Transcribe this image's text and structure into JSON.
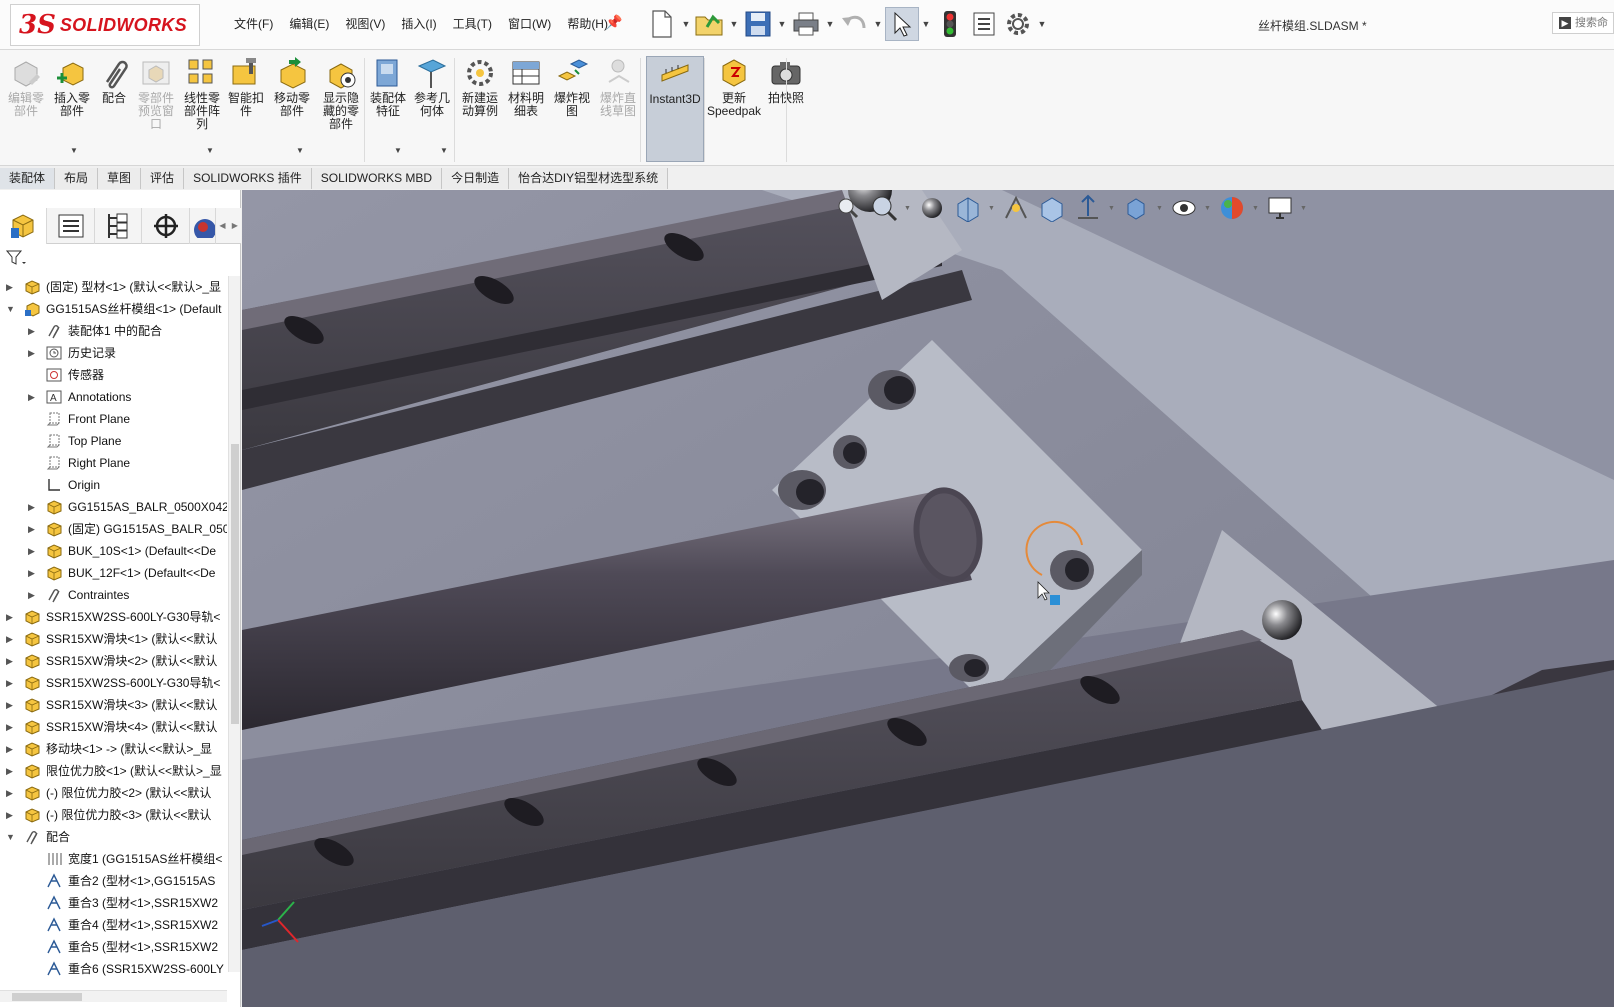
{
  "app": {
    "logo_ds": "3S",
    "logo_text": "SOLIDWORKS",
    "document_title": "丝杆模组.SLDASM *",
    "search_placeholder": "搜索命"
  },
  "menu": [
    "文件(F)",
    "编辑(E)",
    "视图(V)",
    "插入(I)",
    "工具(T)",
    "窗口(W)",
    "帮助(H)"
  ],
  "quick_access_icons": [
    "new-document-icon",
    "open-icon",
    "save-icon",
    "print-icon",
    "undo-icon",
    "select-arrow-icon",
    "rebuild-traffic-light-icon",
    "file-properties-icon",
    "options-gear-icon"
  ],
  "ribbon": [
    {
      "label": "编辑零\n部件",
      "icon": "edit-component-icon",
      "disabled": true
    },
    {
      "label": "插入零\n部件",
      "icon": "insert-component-icon",
      "disabled": false
    },
    {
      "label": "配合",
      "icon": "mate-paperclip-icon",
      "disabled": false
    },
    {
      "label": "零部件\n预览窗\n口",
      "icon": "component-preview-icon",
      "disabled": true
    },
    {
      "label": "线性零\n部件阵\n列",
      "icon": "linear-pattern-icon",
      "disabled": false
    },
    {
      "label": "智能扣\n件",
      "icon": "smart-fasteners-icon",
      "disabled": false
    },
    {
      "label": "移动零\n部件",
      "icon": "move-component-icon",
      "disabled": false
    },
    {
      "label": "显示隐\n藏的零\n部件",
      "icon": "show-hidden-components-icon",
      "disabled": false
    },
    {
      "label": "装配体\n特征",
      "icon": "assembly-features-icon",
      "disabled": false
    },
    {
      "label": "参考几\n何体",
      "icon": "reference-geometry-icon",
      "disabled": false
    },
    {
      "label": "新建运\n动算例",
      "icon": "new-motion-study-icon",
      "disabled": false
    },
    {
      "label": "材料明\n细表",
      "icon": "bill-of-materials-icon",
      "disabled": false
    },
    {
      "label": "爆炸视\n图",
      "icon": "exploded-view-icon",
      "disabled": false
    },
    {
      "label": "爆炸直\n线草图",
      "icon": "explode-line-sketch-icon",
      "disabled": true
    },
    {
      "label": "Instant3D",
      "icon": "instant3d-icon",
      "disabled": false,
      "active": true
    },
    {
      "label": "更新\nSpeedpak",
      "icon": "speedpak-icon",
      "disabled": false
    },
    {
      "label": "拍快照",
      "icon": "snapshot-camera-icon",
      "disabled": false
    }
  ],
  "command_tabs": [
    "装配体",
    "布局",
    "草图",
    "评估",
    "SOLIDWORKS 插件",
    "SOLIDWORKS MBD",
    "今日制造",
    "怡合达DIY铝型材选型系统"
  ],
  "command_tab_active": "装配体",
  "fm_tabs": [
    "featuremanager-icon",
    "propertymanager-icon",
    "configurationmanager-icon",
    "dimxpert-icon",
    "display-manager-icon"
  ],
  "tree": [
    {
      "level": 0,
      "arrow": "right",
      "icon": "part-icon",
      "text": "(固定) 型材<1> (默认<<默认>_显"
    },
    {
      "level": 0,
      "arrow": "down",
      "icon": "subassembly-icon",
      "text": "GG1515AS丝杆模组<1> (Default"
    },
    {
      "level": 1,
      "arrow": "right",
      "icon": "mates-folder-icon",
      "text": "装配体1 中的配合"
    },
    {
      "level": 1,
      "arrow": "right",
      "icon": "history-icon",
      "text": "历史记录"
    },
    {
      "level": 1,
      "arrow": "",
      "icon": "sensor-icon",
      "text": "传感器"
    },
    {
      "level": 1,
      "arrow": "right",
      "icon": "annotations-icon",
      "text": "Annotations"
    },
    {
      "level": 1,
      "arrow": "",
      "icon": "plane-icon",
      "text": "Front Plane"
    },
    {
      "level": 1,
      "arrow": "",
      "icon": "plane-icon",
      "text": "Top Plane"
    },
    {
      "level": 1,
      "arrow": "",
      "icon": "plane-icon",
      "text": "Right Plane"
    },
    {
      "level": 1,
      "arrow": "",
      "icon": "origin-icon",
      "text": "Origin"
    },
    {
      "level": 1,
      "arrow": "right",
      "icon": "part-icon",
      "text": "GG1515AS_BALR_0500X042"
    },
    {
      "level": 1,
      "arrow": "right",
      "icon": "part-icon",
      "text": "(固定) GG1515AS_BALR_050"
    },
    {
      "level": 1,
      "arrow": "right",
      "icon": "part-icon",
      "text": "BUK_10S<1> (Default<<De"
    },
    {
      "level": 1,
      "arrow": "right",
      "icon": "part-icon",
      "text": "BUK_12F<1> (Default<<De"
    },
    {
      "level": 1,
      "arrow": "right",
      "icon": "mates-folder-icon",
      "text": "Contraintes"
    },
    {
      "level": 0,
      "arrow": "right",
      "icon": "part-icon",
      "text": "SSR15XW2SS-600LY-G30导轨<"
    },
    {
      "level": 0,
      "arrow": "right",
      "icon": "part-icon",
      "text": "SSR15XW滑块<1> (默认<<默认"
    },
    {
      "level": 0,
      "arrow": "right",
      "icon": "part-icon",
      "text": "SSR15XW滑块<2> (默认<<默认"
    },
    {
      "level": 0,
      "arrow": "right",
      "icon": "part-icon",
      "text": "SSR15XW2SS-600LY-G30导轨<"
    },
    {
      "level": 0,
      "arrow": "right",
      "icon": "part-icon",
      "text": "SSR15XW滑块<3> (默认<<默认"
    },
    {
      "level": 0,
      "arrow": "right",
      "icon": "part-icon",
      "text": "SSR15XW滑块<4> (默认<<默认"
    },
    {
      "level": 0,
      "arrow": "right",
      "icon": "part-icon",
      "text": "移动块<1> -> (默认<<默认>_显"
    },
    {
      "level": 0,
      "arrow": "right",
      "icon": "part-icon",
      "text": "限位优力胶<1> (默认<<默认>_显"
    },
    {
      "level": 0,
      "arrow": "right",
      "icon": "part-icon",
      "text": "(-) 限位优力胶<2> (默认<<默认"
    },
    {
      "level": 0,
      "arrow": "right",
      "icon": "part-icon",
      "text": "(-) 限位优力胶<3> (默认<<默认"
    },
    {
      "level": 0,
      "arrow": "down",
      "icon": "mates-folder-icon",
      "text": "配合"
    },
    {
      "level": 1,
      "arrow": "",
      "icon": "width-mate-icon",
      "text": "宽度1 (GG1515AS丝杆模组<"
    },
    {
      "level": 1,
      "arrow": "",
      "icon": "coincident-mate-icon",
      "text": "重合2 (型材<1>,GG1515AS"
    },
    {
      "level": 1,
      "arrow": "",
      "icon": "coincident-mate-icon",
      "text": "重合3 (型材<1>,SSR15XW2"
    },
    {
      "level": 1,
      "arrow": "",
      "icon": "coincident-mate-icon",
      "text": "重合4 (型材<1>,SSR15XW2"
    },
    {
      "level": 1,
      "arrow": "",
      "icon": "coincident-mate-icon",
      "text": "重合5 (型材<1>,SSR15XW2"
    },
    {
      "level": 1,
      "arrow": "",
      "icon": "coincident-mate-icon",
      "text": "重合6 (SSR15XW2SS-600LY"
    }
  ],
  "heads_up_toolbar": [
    "zoom-to-fit-icon",
    "zoom-area-icon",
    "previous-view-icon",
    "section-view-icon",
    "dynamic-annotation-icon",
    "view-orientation-icon",
    "display-style-icon",
    "hide-show-icon",
    "edit-appearance-icon",
    "apply-scene-icon",
    "view-settings-icon"
  ],
  "colors": {
    "viewport_bg": "#8a8c9c",
    "rail": "#4a4750",
    "plate": "#b9bdc8",
    "block_face": "#a6aab8",
    "accent_brand": "#d6141e",
    "selection_orange": "#e58a3a"
  }
}
